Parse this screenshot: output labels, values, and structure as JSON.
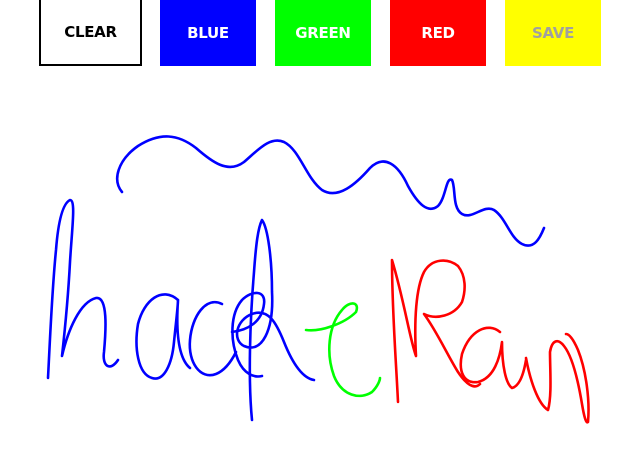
{
  "toolbar": {
    "clear_label": "CLEAR",
    "blue_label": "BLUE",
    "green_label": "GREEN",
    "red_label": "RED",
    "save_label": "SAVE"
  },
  "colors": {
    "blue": "#0000ff",
    "green": "#00ff00",
    "red": "#ff0000",
    "save": "#ffff00",
    "background": "#ffffff"
  }
}
